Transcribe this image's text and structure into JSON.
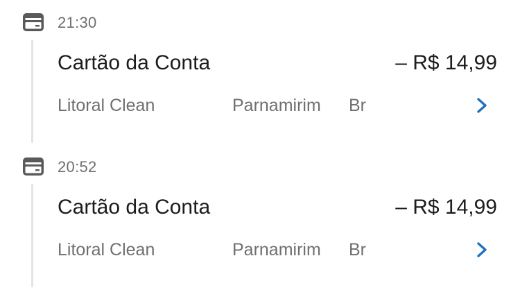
{
  "transactions": [
    {
      "time": "21:30",
      "title": "Cartão da Conta",
      "amount": "– R$ 14,99",
      "merchant": "Litoral Clean",
      "city": "Parnamirim",
      "country": "Br",
      "icon": "credit-card-icon",
      "detail_icon": "chevron-right-icon"
    },
    {
      "time": "20:52",
      "title": "Cartão da Conta",
      "amount": "– R$ 14,99",
      "merchant": "Litoral Clean",
      "city": "Parnamirim",
      "country": "Br",
      "icon": "credit-card-icon",
      "detail_icon": "chevron-right-icon"
    }
  ],
  "colors": {
    "text_primary": "#1c1c1c",
    "text_secondary": "#6f6f6f",
    "icon": "#5a5a5a",
    "chevron": "#1e73be",
    "timeline": "#e4e4e4"
  }
}
